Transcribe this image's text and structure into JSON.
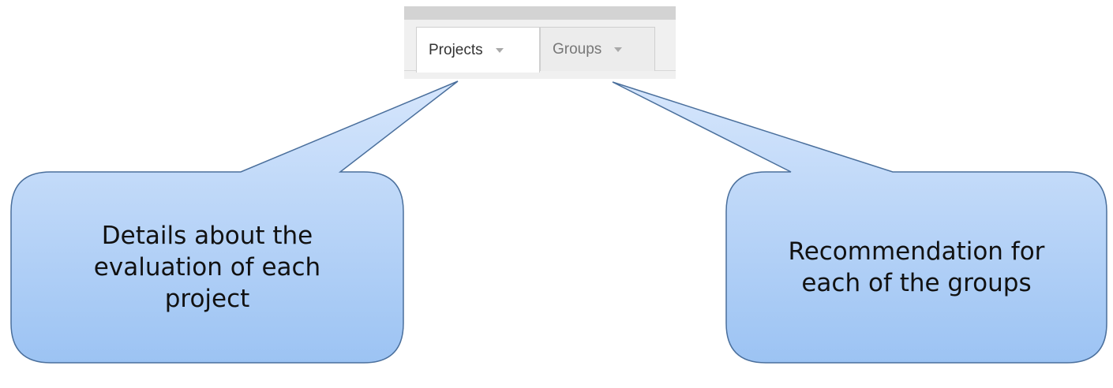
{
  "tabs": [
    {
      "label": "Projects",
      "active": true
    },
    {
      "label": "Groups",
      "active": false
    }
  ],
  "callouts": {
    "left": {
      "text": "Details about the evaluation of each project"
    },
    "right": {
      "text": "Recommendation for each of the groups"
    }
  },
  "colors": {
    "callout_fill_top": "#d6e6fc",
    "callout_fill_bottom": "#9cc3f3",
    "callout_stroke": "#4a6f9c",
    "tab_active_bg": "#ffffff",
    "tab_inactive_bg": "#ececec",
    "strip_bg": "#f0f0f0",
    "strip_topbar": "#d3d3d3"
  },
  "icons": {
    "tab_dropdown": "chevron-down-icon"
  }
}
